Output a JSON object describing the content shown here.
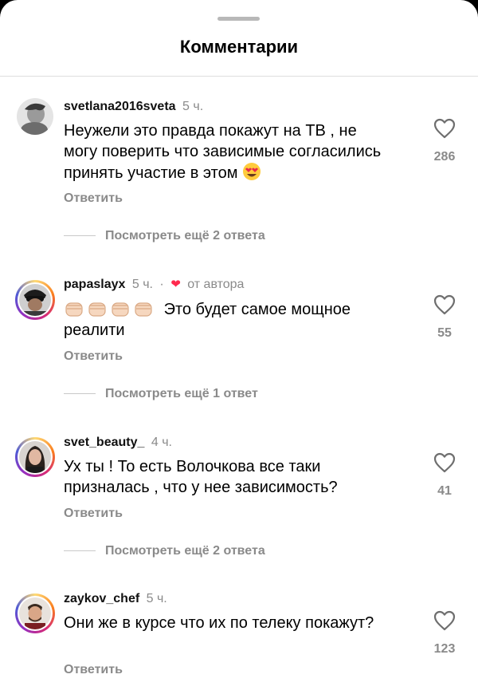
{
  "header": {
    "title": "Комментарии"
  },
  "comments": [
    {
      "user": "svetlana2016sveta",
      "time": "5 ч.",
      "text": "Неужели это правда покажут на ТВ , не могу поверить что зависимые согласились принять участие в этом",
      "likes": "286",
      "reply_label": "Ответить",
      "more_label": "Посмотреть ещё 2 ответа"
    },
    {
      "user": "papaslayx",
      "time": "5 ч.",
      "author_label": "от автора",
      "emoji": "✊🏻✊🏻✊🏻✊🏻",
      "text": "Это будет самое мощное реалити",
      "likes": "55",
      "reply_label": "Ответить",
      "more_label": "Посмотреть ещё 1 ответ"
    },
    {
      "user": "svet_beauty_",
      "time": "4 ч.",
      "text": "Ух ты ! То есть Волочкова все таки призналась , что у нее зависимость?",
      "likes": "41",
      "reply_label": "Ответить",
      "more_label": "Посмотреть ещё 2 ответа"
    },
    {
      "user": "zaykov_chef",
      "time": "5 ч.",
      "text": "Они же в курсе что их по телеку покажут?",
      "likes": "123",
      "reply_label": "Ответить"
    }
  ],
  "icons": {
    "like": "heart-outline-icon",
    "author_like": "heart-filled-icon",
    "emoji_fist": "raised-fist-emoji",
    "emoji_love": "heart-eyes-emoji"
  },
  "colors": {
    "heart": "#ff2a4e",
    "muted": "#8a8a8a"
  }
}
